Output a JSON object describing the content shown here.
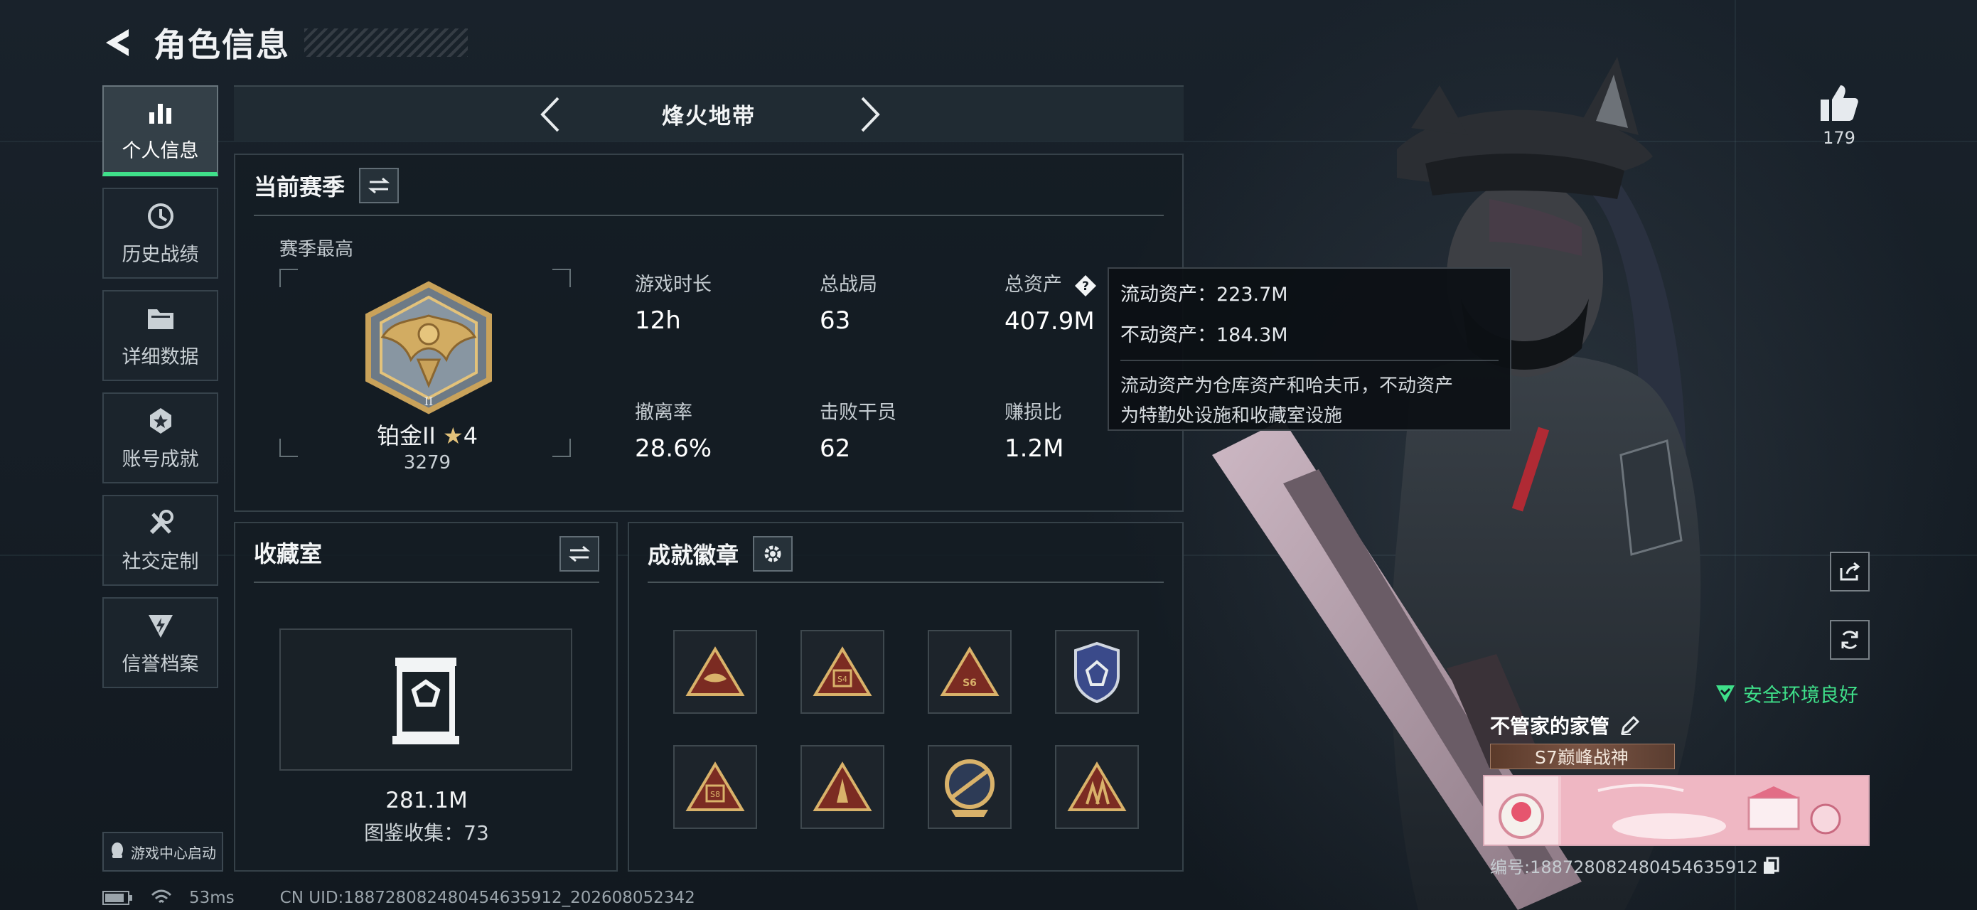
{
  "header": {
    "title": "角色信息"
  },
  "sidebar": {
    "items": [
      {
        "label": "个人信息",
        "icon": "bar-chart-icon",
        "active": true
      },
      {
        "label": "历史战绩",
        "icon": "history-icon"
      },
      {
        "label": "详细数据",
        "icon": "folder-icon"
      },
      {
        "label": "账号成就",
        "icon": "medal-icon"
      },
      {
        "label": "社交定制",
        "icon": "tools-icon"
      },
      {
        "label": "信誉档案",
        "icon": "shield-bolt-icon"
      }
    ],
    "game_center": "游戏中心启动"
  },
  "mode": {
    "title": "烽火地带"
  },
  "season": {
    "title": "当前赛季",
    "sub": "赛季最高",
    "rank_name": "铂金II",
    "rank_stars": "4",
    "rank_score": "3279",
    "stats": [
      {
        "label": "游戏时长",
        "value": "12h"
      },
      {
        "label": "总战局",
        "value": "63"
      },
      {
        "label": "总资产",
        "value": "407.9M"
      },
      {
        "label": "撤离率",
        "value": "28.6%"
      },
      {
        "label": "击败干员",
        "value": "62"
      },
      {
        "label": "赚损比",
        "value": "1.2M"
      }
    ]
  },
  "tooltip": {
    "liquid": "流动资产：223.7M",
    "fixed": "不动资产：184.3M",
    "desc_line1": "流动资产为仓库资产和哈夫币，不动资产",
    "desc_line2": "为特勤处设施和收藏室设施"
  },
  "collection": {
    "title": "收藏室",
    "value": "281.1M",
    "count": "图鉴收集：73"
  },
  "badges": {
    "title": "成就徽章",
    "items": [
      "S5-badge",
      "S4-badge",
      "S6-badge",
      "shield-badge",
      "S8-badge",
      "tower-badge",
      "emblem-badge",
      "squad-badge"
    ],
    "labels": [
      "",
      "S4",
      "S6",
      "",
      "S8",
      "",
      "",
      ""
    ]
  },
  "status": {
    "ping": "53ms",
    "uid": "CN UID:18872808248045463​5912_202608052342"
  },
  "profile": {
    "likes": "179",
    "safe": "安全环境良好",
    "name": "不管家的家管",
    "title_plate": "S7巅峰战神",
    "id_line": "编号:18872808248045463​5912"
  },
  "colors": {
    "accent": "#3fe08a",
    "gold": "#c9a25a"
  }
}
